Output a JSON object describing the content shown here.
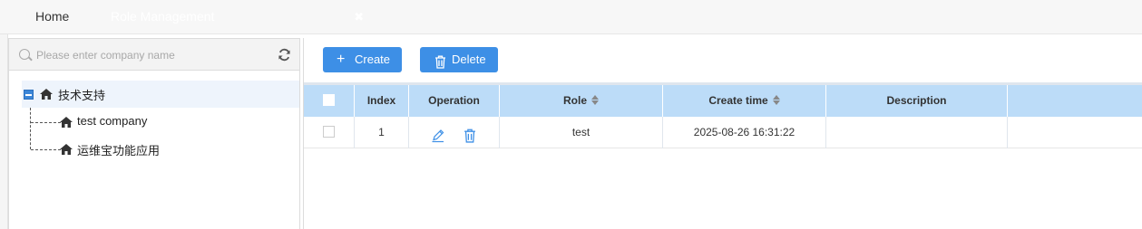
{
  "tabs": {
    "home_label": "Home",
    "active_label": "Role Management",
    "close_glyph": "✖"
  },
  "sidebar": {
    "search_placeholder": "Please enter company name",
    "search_value": "",
    "root": {
      "label": "技术支持",
      "icon": "home-icon",
      "expanded": true
    },
    "children": [
      {
        "label": "test company",
        "icon": "home-icon"
      },
      {
        "label": "运维宝功能应用",
        "icon": "home-icon"
      }
    ]
  },
  "toolbar": {
    "create_label": "Create",
    "create_icon": "+",
    "delete_label": "Delete",
    "delete_icon": "trash-icon"
  },
  "table": {
    "columns": [
      "",
      "Index",
      "Operation",
      "Role",
      "Create time",
      "Description",
      ""
    ],
    "sortable": [
      "Role",
      "Create time"
    ],
    "rows": [
      {
        "index": "1",
        "role": "test",
        "create_time": "2025-08-26 16:31:22",
        "description": ""
      }
    ]
  },
  "colors": {
    "accent": "#3d8fe6",
    "tab_active": "#1a6fd1",
    "header_bg": "#bcdcf8",
    "tree_selected": "#eef4fc"
  }
}
